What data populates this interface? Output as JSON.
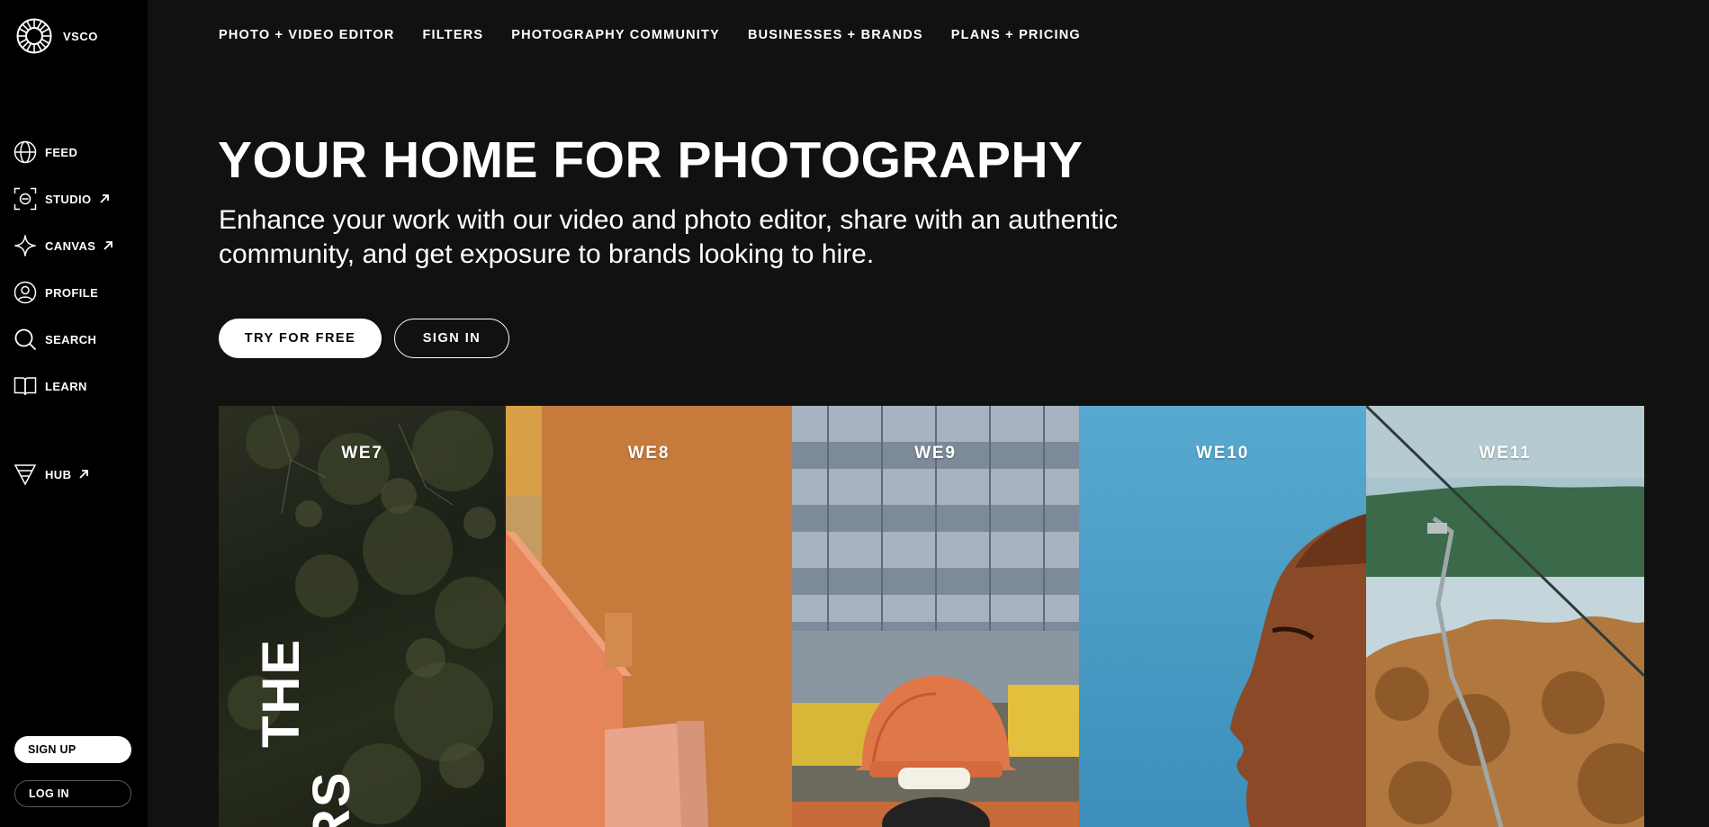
{
  "brand": {
    "name": "VSCO"
  },
  "sidebar": {
    "items": [
      {
        "label": "FEED",
        "icon": "globe-icon",
        "external": false
      },
      {
        "label": "STUDIO",
        "icon": "studio-icon",
        "external": true
      },
      {
        "label": "CANVAS",
        "icon": "sparkle-icon",
        "external": true
      },
      {
        "label": "PROFILE",
        "icon": "profile-icon",
        "external": false
      },
      {
        "label": "SEARCH",
        "icon": "search-icon",
        "external": false
      },
      {
        "label": "LEARN",
        "icon": "book-icon",
        "external": false
      },
      {
        "label": "HUB",
        "icon": "hub-icon",
        "external": true
      }
    ],
    "signup_label": "SIGN UP",
    "login_label": "LOG IN"
  },
  "topnav": {
    "links": [
      "PHOTO + VIDEO EDITOR",
      "FILTERS",
      "PHOTOGRAPHY COMMUNITY",
      "BUSINESSES + BRANDS",
      "PLANS + PRICING"
    ]
  },
  "hero": {
    "title": "YOUR HOME FOR PHOTOGRAPHY",
    "subtitle": "Enhance your work with our video and photo editor, share with an authentic community, and get exposure to brands looking to hire.",
    "try_label": "TRY FOR FREE",
    "signin_label": "SIGN IN"
  },
  "gallery": {
    "panels": [
      {
        "label": "WE7"
      },
      {
        "label": "WE8"
      },
      {
        "label": "WE9"
      },
      {
        "label": "WE10"
      },
      {
        "label": "WE11"
      }
    ],
    "vertical_text_1": "THE",
    "vertical_text_2": "RS"
  },
  "colors": {
    "page_bg": "#111111",
    "sidebar_bg": "#000000",
    "text": "#ffffff"
  }
}
